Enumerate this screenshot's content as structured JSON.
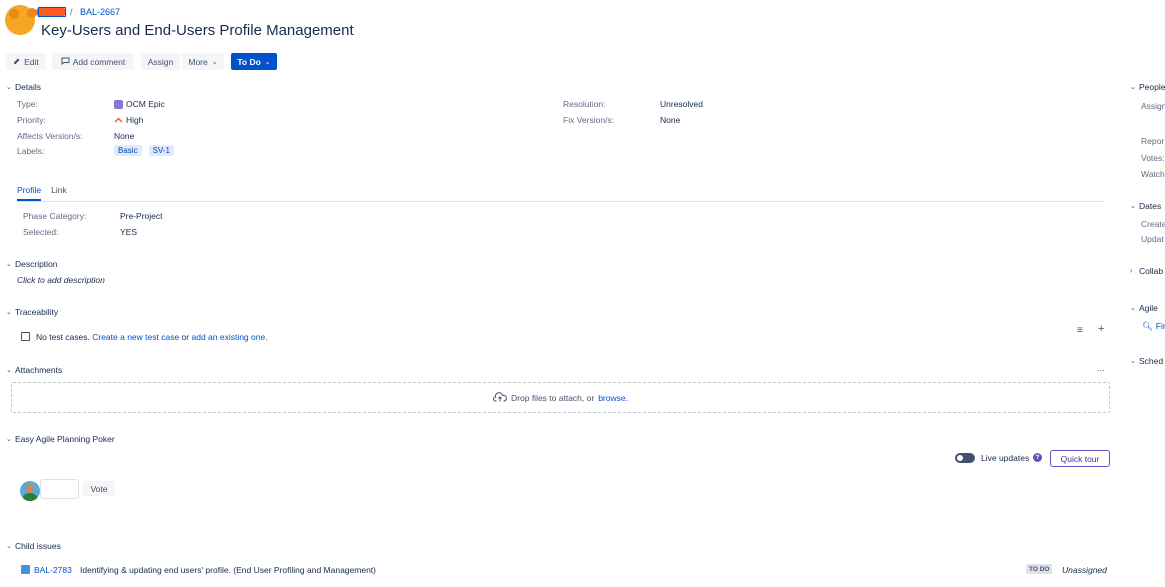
{
  "breadcrumb": {
    "separator": "/",
    "issue_key": "BAL-2667"
  },
  "issue": {
    "title": "Key-Users and End-Users Profile Management"
  },
  "toolbar": {
    "edit_label": "Edit",
    "comment_label": "Add comment",
    "assign_label": "Assign",
    "more_label": "More",
    "status_label": "To Do"
  },
  "details": {
    "heading": "Details",
    "type_label": "Type:",
    "type_value": "OCM Epic",
    "priority_label": "Priority:",
    "priority_value": "High",
    "affects_label": "Affects Version/s:",
    "affects_value": "None",
    "labels_label": "Labels:",
    "labels": [
      "Basic",
      "SV-1"
    ],
    "resolution_label": "Resolution:",
    "resolution_value": "Unresolved",
    "fix_label": "Fix Version/s:",
    "fix_value": "None"
  },
  "tabs": [
    {
      "label": "Profile",
      "active": true
    },
    {
      "label": "Link",
      "active": false
    }
  ],
  "profile": {
    "phase_label": "Phase Category:",
    "phase_value": "Pre-Project",
    "selected_label": "Selected:",
    "selected_value": "YES"
  },
  "description": {
    "heading": "Description",
    "placeholder": "Click to add description"
  },
  "traceability": {
    "heading": "Traceability",
    "text_prefix": "No test cases.",
    "create_link": "Create a new test case",
    "or_text": "or",
    "add_link": "add an existing one."
  },
  "attachments": {
    "heading": "Attachments",
    "more_icon": "...",
    "drop_text": "Drop files to attach, or",
    "browse_link": "browse."
  },
  "poker": {
    "heading": "Easy Agile Planning Poker",
    "live_updates": "Live updates",
    "help_glyph": "?",
    "quick_tour": "Quick tour",
    "vote_label": "Vote"
  },
  "child_issues": {
    "heading": "Child issues",
    "items": [
      {
        "key": "BAL-2783",
        "summary": "Identifying & updating end users' profile. (End User Profiling and Management)",
        "status": "TO DO",
        "assignee": "Unassigned"
      }
    ]
  },
  "right_panel": {
    "people_heading": "People",
    "assignee_label": "Assign",
    "reporter_label": "Repor",
    "votes_label": "Votes:",
    "watchers_label": "Watch",
    "dates_heading": "Dates",
    "created_label": "Create",
    "updated_label": "Updat",
    "collab_heading": "Collab",
    "agile_heading": "Agile",
    "agile_link": "Fir",
    "sched_heading": "Sched"
  },
  "icons": {
    "edit": "pencil-icon",
    "comment": "comment-icon",
    "more_chevron": "chevron-down-icon",
    "epic": "epic-icon",
    "priority": "priority-high-icon",
    "cloud_upload": "cloud-upload-icon",
    "list": "list-icon",
    "add": "plus-icon"
  },
  "colors": {
    "primary": "#0052cc",
    "epic": "#8777d9",
    "priority_high": "#ff5630",
    "poker_accent": "#6554c0"
  }
}
